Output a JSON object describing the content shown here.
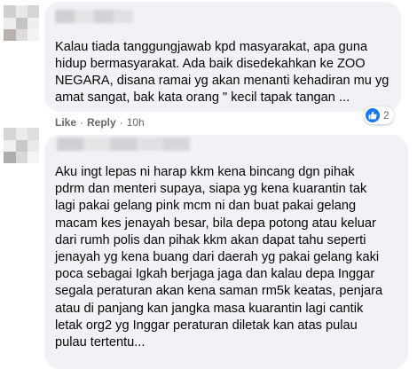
{
  "comments": [
    {
      "text": "Kalau tiada tanggungjawab kpd masyarakat, apa guna\nhidup bermasyarakat. Ada baik disedekahkan ke ZOO\nNEGARA, disana ramai yg akan menanti kehadiran mu yg\namat sangat, bak kata orang \" kecil tapak tangan ...",
      "like_label": "Like",
      "reply_label": "Reply",
      "time": "10h",
      "reaction_count": "2",
      "reaction_icon": "like-icon"
    },
    {
      "text": "Aku ingt lepas ni harap kkm kena bincang dgn pihak\npdrm dan menteri supaya, siapa yg kena kuarantin tak\nlagi pakai gelang pink mcm ni dan buat pakai gelang\nmacam kes jenayah besar, bila depa potong atau keluar\ndari rumh polis dan pihak kkm akan dapat tahu seperti\njenayah yg kena buang dari daerah yg pakai gelang kaki\npoca sebagai Igkah berjaga jaga dan kalau depa Inggar\nsegala peraturan akan kena saman rm5k keatas, penjara\natau di panjang kan jangka masa kuarantin lagi cantik\nletak org2 yg Inggar peraturan diletak kan atas pulau\npulau tertentu..."
    }
  ],
  "colors": {
    "bubble": "#f0f2f5",
    "meta_text": "#65676b",
    "like_blue": "#1877f2"
  }
}
